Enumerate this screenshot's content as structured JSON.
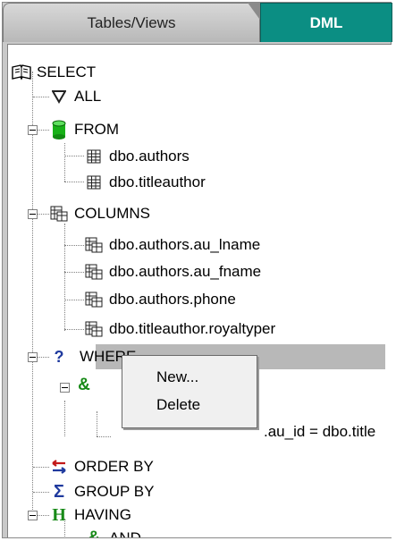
{
  "tabs": {
    "inactive": "Tables/Views",
    "active": "DML"
  },
  "tree": {
    "root": "SELECT",
    "all": "ALL",
    "from": "FROM",
    "from_items": [
      "dbo.authors",
      "dbo.titleauthor"
    ],
    "columns": "COLUMNS",
    "column_items": [
      "dbo.authors.au_lname",
      "dbo.authors.au_fname",
      "dbo.authors.phone",
      "dbo.titleauthor.royaltyper"
    ],
    "where": "WHERE",
    "condition": ".au_id = dbo.title",
    "order_by": "ORDER BY",
    "group_by": "GROUP BY",
    "having": "HAVING",
    "and": "AND"
  },
  "context_menu": {
    "new": "New...",
    "delete": "Delete"
  }
}
